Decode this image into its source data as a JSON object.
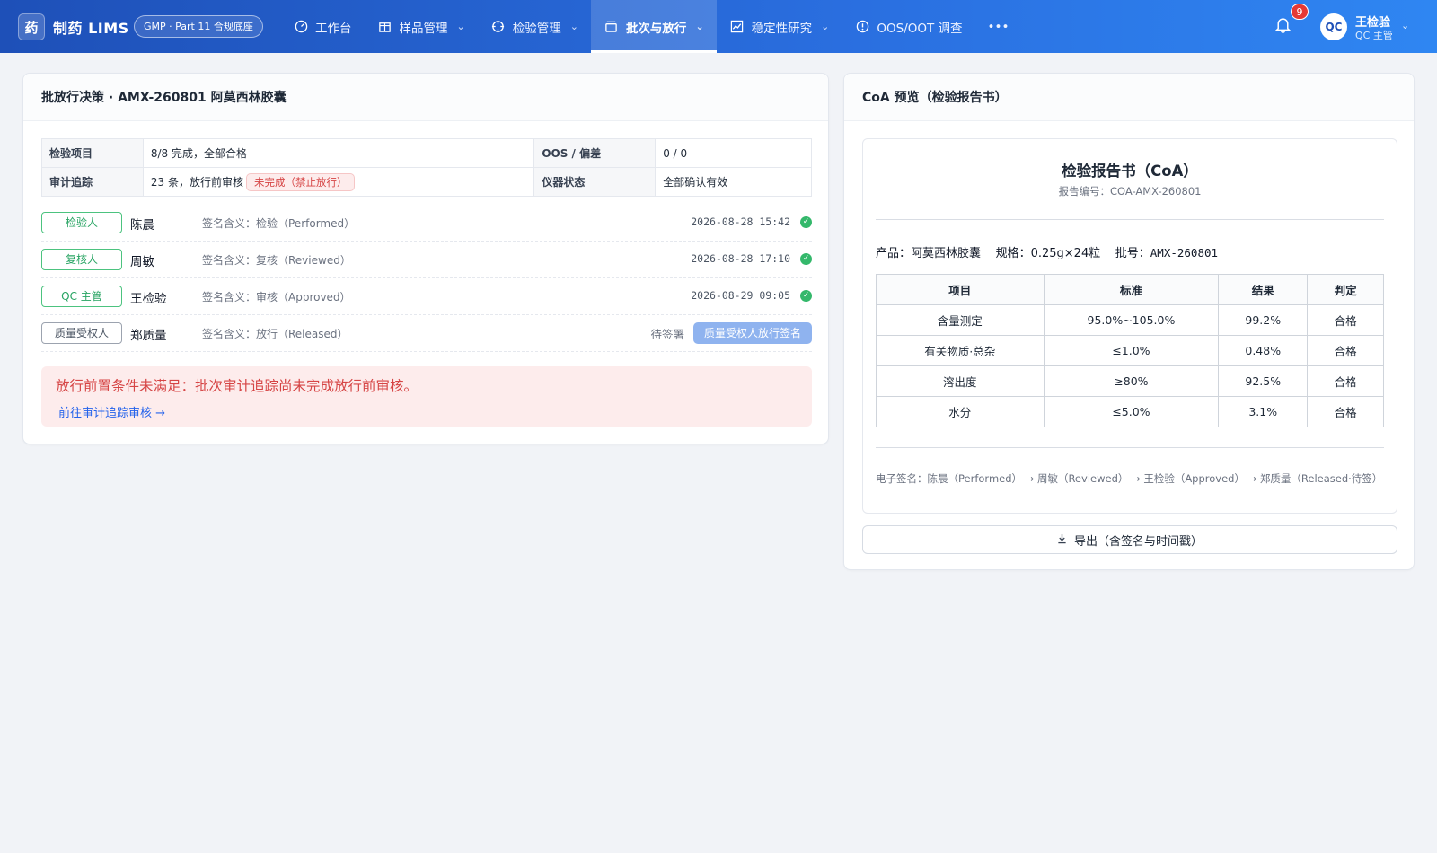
{
  "header": {
    "logo_char": "药",
    "app_title": "制药 LIMS",
    "gmp_badge": "GMP · Part 11 合规底座",
    "nav": [
      {
        "label": "工作台",
        "icon": "dashboard-icon",
        "has_menu": false,
        "active": false
      },
      {
        "label": "样品管理",
        "icon": "package-icon",
        "has_menu": true,
        "active": false
      },
      {
        "label": "检验管理",
        "icon": "crosshair-icon",
        "has_menu": true,
        "active": false
      },
      {
        "label": "批次与放行",
        "icon": "box-icon",
        "has_menu": true,
        "active": true
      },
      {
        "label": "稳定性研究",
        "icon": "trend-icon",
        "has_menu": true,
        "active": false
      },
      {
        "label": "OOS/OOT 调查",
        "icon": "alert-circle-icon",
        "has_menu": false,
        "active": false
      }
    ],
    "more": "•••",
    "notification_count": "9",
    "user": {
      "avatar": "QC",
      "name": "王检验",
      "role": "QC 主管"
    }
  },
  "release": {
    "title": "批放行决策 · AMX-260801 阿莫西林胶囊",
    "info": {
      "test_items_label": "检验项目",
      "test_items_value": "8/8 完成，全部合格",
      "oos_label": "OOS / 偏差",
      "oos_value": "0 / 0",
      "audit_label": "审计追踪",
      "audit_value": "23 条，放行前审核",
      "audit_tag": "未完成（禁止放行）",
      "instrument_label": "仪器状态",
      "instrument_value": "全部确认有效"
    },
    "signatures": [
      {
        "role": "检验人",
        "name": "陈晨",
        "meaning": "签名含义：检验（Performed）",
        "time": "2026-08-28 15:42",
        "signed": true
      },
      {
        "role": "复核人",
        "name": "周敏",
        "meaning": "签名含义：复核（Reviewed）",
        "time": "2026-08-28 17:10",
        "signed": true
      },
      {
        "role": "QC 主管",
        "name": "王检验",
        "meaning": "签名含义：审核（Approved）",
        "time": "2026-08-29 09:05",
        "signed": true
      },
      {
        "role": "质量受权人",
        "name": "郑质量",
        "meaning": "签名含义：放行（Released）",
        "pending": "待签署",
        "button": "质量受权人放行签名",
        "signed": false
      }
    ],
    "alert": {
      "text": "放行前置条件未满足：批次审计追踪尚未完成放行前审核。",
      "link": "前往审计追踪审核 →"
    }
  },
  "coa": {
    "panel_title": "CoA 预览（检验报告书）",
    "doc_title": "检验报告书（CoA）",
    "report_no": "报告编号：COA-AMX-260801",
    "product_label": "产品：",
    "product": "阿莫西林胶囊",
    "spec_label": "规格：",
    "spec": "0.25g×24粒",
    "batch_label": "批号：",
    "batch": "AMX-260801",
    "columns": [
      "项目",
      "标准",
      "结果",
      "判定"
    ],
    "rows": [
      [
        "含量测定",
        "95.0%~105.0%",
        "99.2%",
        "合格"
      ],
      [
        "有关物质·总杂",
        "≤1.0%",
        "0.48%",
        "合格"
      ],
      [
        "溶出度",
        "≥80%",
        "92.5%",
        "合格"
      ],
      [
        "水分",
        "≤5.0%",
        "3.1%",
        "合格"
      ]
    ],
    "esign": "电子签名：陈晨（Performed） → 周敏（Reviewed） → 王检验（Approved） → 郑质量（Released·待签）",
    "export_label": "导出（含签名与时间戳）"
  },
  "colors": {
    "brand": "#2a6fe0",
    "success": "#34b86b",
    "danger": "#d64545",
    "link": "#2563eb"
  }
}
